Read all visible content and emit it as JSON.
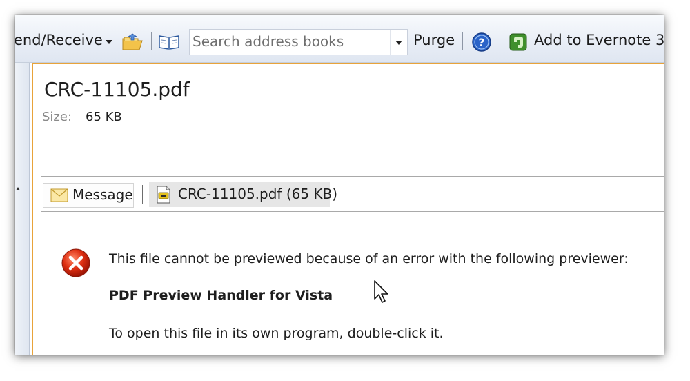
{
  "toolbar": {
    "send_receive_label": "end/Receive",
    "search_placeholder": "Search address books",
    "purge_label": "Purge",
    "evernote_label": "Add to Evernote 3.",
    "colors": {
      "help_blue": "#2a63c8",
      "evernote_green": "#3f8f2c"
    }
  },
  "reading_pane": {
    "file_title": "CRC-11105.pdf",
    "size_label": "Size:",
    "size_value": "65 KB",
    "accent_color": "#e8a33a"
  },
  "attachments": {
    "message_label": "Message",
    "file_label": "CRC-11105.pdf (65 KB)"
  },
  "error_message": {
    "line1": "This file cannot be previewed because of an error with the following previewer:",
    "previewer": "PDF Preview Handler for Vista",
    "line3": "To open this file in its own program, double-click it.",
    "icon": "error-x-icon"
  }
}
